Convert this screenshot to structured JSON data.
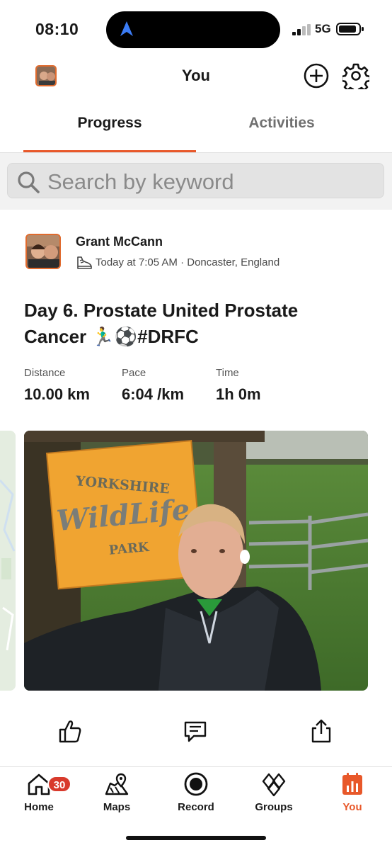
{
  "status_bar": {
    "time": "08:10",
    "network": "5G"
  },
  "header": {
    "title": "You"
  },
  "tabs": [
    {
      "label": "Progress",
      "active": true
    },
    {
      "label": "Activities",
      "active": false
    }
  ],
  "search": {
    "placeholder": "Search by keyword"
  },
  "activity": {
    "athlete_name": "Grant McCann",
    "meta": "Today at 7:05 AM · Doncaster, England",
    "title": "Day 6. Prostate United Prostate Cancer 🏃‍♂️⚽#DRFC",
    "stats": [
      {
        "label": "Distance",
        "value": "10.00 km"
      },
      {
        "label": "Pace",
        "value": "6:04 /km"
      },
      {
        "label": "Time",
        "value": "1h 0m"
      }
    ],
    "photo_sign_text": [
      "YORKSHIRE",
      "WildLife",
      "PARK"
    ]
  },
  "bottom_nav": {
    "items": [
      {
        "label": "Home",
        "icon": "home-icon",
        "badge": "30"
      },
      {
        "label": "Maps",
        "icon": "map-icon"
      },
      {
        "label": "Record",
        "icon": "record-icon"
      },
      {
        "label": "Groups",
        "icon": "groups-icon"
      },
      {
        "label": "You",
        "icon": "you-icon",
        "active": true
      }
    ]
  },
  "colors": {
    "accent": "#e8582a",
    "badge": "#d83a2c",
    "search_bg": "#e3e3e3"
  }
}
